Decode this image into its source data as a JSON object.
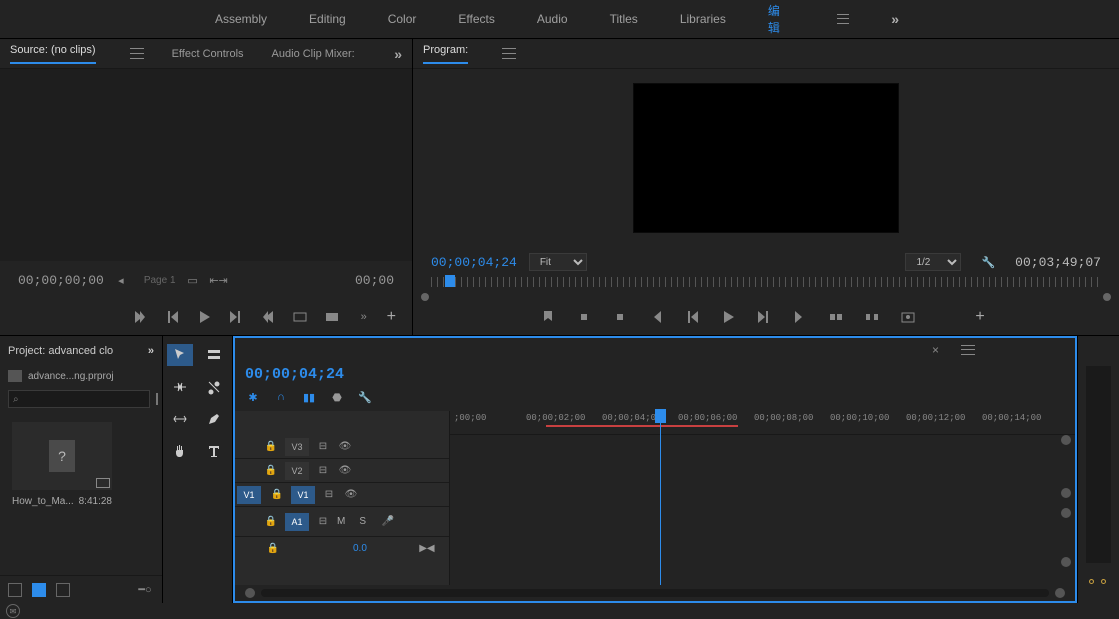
{
  "workspace_tabs": [
    "Assembly",
    "Editing",
    "Color",
    "Effects",
    "Audio",
    "Titles",
    "Libraries"
  ],
  "workspace_active": "编辑",
  "source": {
    "tabs": [
      "Source: (no clips)",
      "Effect Controls",
      "Audio Clip Mixer:"
    ],
    "tc_left": "00;00;00;00",
    "page_label": "Page 1",
    "tc_right": "00;00"
  },
  "program": {
    "tab": "Program:",
    "tc_left": "00;00;04;24",
    "fit": "Fit",
    "res": "1/2",
    "tc_right": "00;03;49;07"
  },
  "project": {
    "title": "Project: advanced clo",
    "file": "advance...ng.prproj",
    "search_placeholder": "⌕",
    "clip_name": "How_to_Ma...",
    "clip_dur": "8:41:28"
  },
  "timeline": {
    "tc": "00;00;04;24",
    "tracks": {
      "v3": "V3",
      "v2": "V2",
      "v1": "V1",
      "a1": "A1",
      "src_v1": "V1",
      "mute": "M",
      "solo": "S"
    },
    "level": "0.0",
    "ruler_ticks": [
      ";00;00",
      "00;00;02;00",
      "00;00;04;00",
      "00;00;06;00",
      "00;00;08;00",
      "00;00;10;00",
      "00;00;12;00",
      "00;00;14;00"
    ]
  },
  "icons": {
    "overflow": "»",
    "plus": "+",
    "close": "×"
  }
}
